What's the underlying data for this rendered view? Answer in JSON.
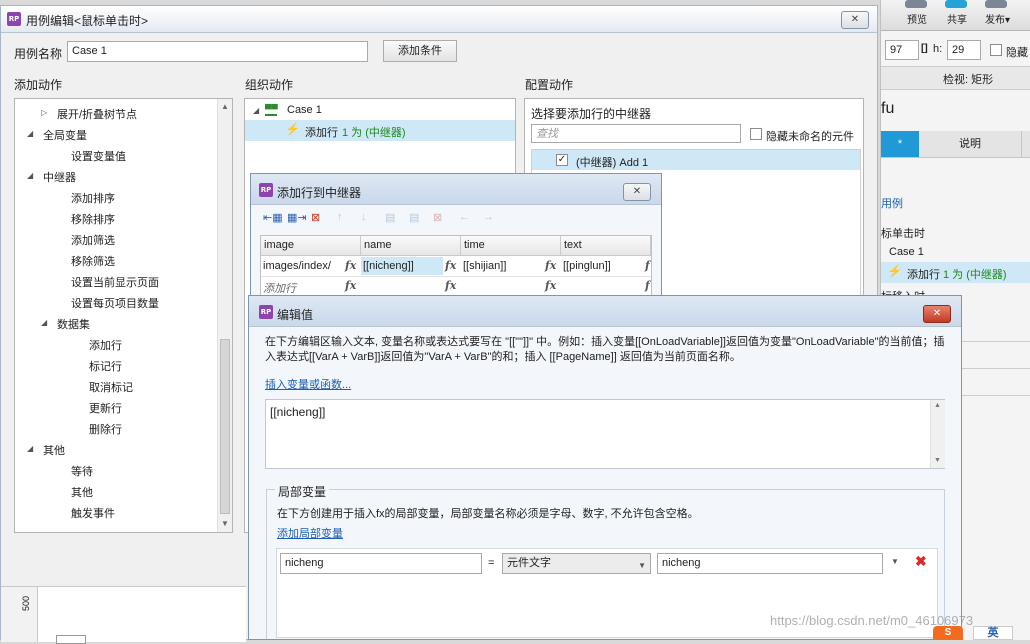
{
  "right_panel": {
    "toolbar": {
      "preview": "预览",
      "share": "共享",
      "publish": "发布▾"
    },
    "w_value": "97",
    "h_label": "h:",
    "h_value": "29",
    "hide_label": "隐藏",
    "inspect_label": "检视: 矩形",
    "fragment_title": "fu",
    "tab_star": "*",
    "tab_desc": "说明",
    "use_case_link": "用例",
    "event_label": "标单击时",
    "case_label": "Case 1",
    "action_text": "添加行",
    "action_detail": "1 为 (中继器)",
    "next_event": "标移入时"
  },
  "main_dialog": {
    "title": "用例编辑<鼠标单击时>",
    "close": "✕",
    "case_name_label": "用例名称",
    "case_name_value": "Case 1",
    "add_condition": "添加条件",
    "col1_header": "添加动作",
    "col2_header": "组织动作",
    "col3_header": "配置动作",
    "actions_tree": [
      {
        "label": "展开/折叠树节点",
        "arrow": "▷"
      },
      {
        "label": "全局变量",
        "arrow": "◢"
      },
      {
        "label": "设置变量值",
        "arrow": ""
      },
      {
        "label": "中继器",
        "arrow": "◢"
      },
      {
        "label": "添加排序",
        "arrow": ""
      },
      {
        "label": "移除排序",
        "arrow": ""
      },
      {
        "label": "添加筛选",
        "arrow": ""
      },
      {
        "label": "移除筛选",
        "arrow": ""
      },
      {
        "label": "设置当前显示页面",
        "arrow": ""
      },
      {
        "label": "设置每页项目数量",
        "arrow": ""
      },
      {
        "label": "数据集",
        "arrow": "◢"
      },
      {
        "label": "添加行",
        "arrow": ""
      },
      {
        "label": "标记行",
        "arrow": ""
      },
      {
        "label": "取消标记",
        "arrow": ""
      },
      {
        "label": "更新行",
        "arrow": ""
      },
      {
        "label": "删除行",
        "arrow": ""
      },
      {
        "label": "其他",
        "arrow": "◢"
      },
      {
        "label": "等待",
        "arrow": ""
      },
      {
        "label": "其他",
        "arrow": ""
      },
      {
        "label": "触发事件",
        "arrow": ""
      }
    ],
    "org_case": "Case 1",
    "org_action_prefix": "添加行",
    "org_action_detail": "1 为 (中继器)",
    "config_title": "选择要添加行的中继器",
    "search_placeholder": "查找",
    "hide_unnamed": "隐藏未命名的元件",
    "repeater_item": "(中继器) Add 1"
  },
  "add_row_dialog": {
    "title": "添加行到中继器",
    "close": "✕",
    "columns": [
      "image",
      "name",
      "time",
      "text"
    ],
    "row1": [
      "images/index/",
      "[[nicheng]]",
      "[[shijian]]",
      "[[pinglun]]"
    ],
    "row2_label": "添加行",
    "fx": "fx",
    "fx_short": "f"
  },
  "edit_value_dialog": {
    "title": "编辑值",
    "close": "✕",
    "description": "在下方编辑区输入文本, 变量名称或表达式要写在 \"[[\"\"]]\" 中。例如：插入变量[[OnLoadVariable]]返回值为变量\"OnLoadVariable\"的当前值；插入表达式[[VarA + VarB]]返回值为\"VarA + VarB\"的和；插入 [[PageName]] 返回值为当前页面名称。",
    "insert_link": "插入变量或函数...",
    "editor_value": "[[nicheng]]",
    "local_var_title": "局部变量",
    "local_var_desc": "在下方创建用于插入fx的局部变量，局部变量名称必须是字母、数字, 不允许包含空格。",
    "add_local_link": "添加局部变量",
    "var_name": "nicheng",
    "equals": "=",
    "var_type": "元件文字",
    "var_target": "nicheng"
  },
  "bottom": {
    "ruler_value": "500",
    "watermark": "https://blog.csdn.net/m0_46106973",
    "ime_label": "英"
  }
}
